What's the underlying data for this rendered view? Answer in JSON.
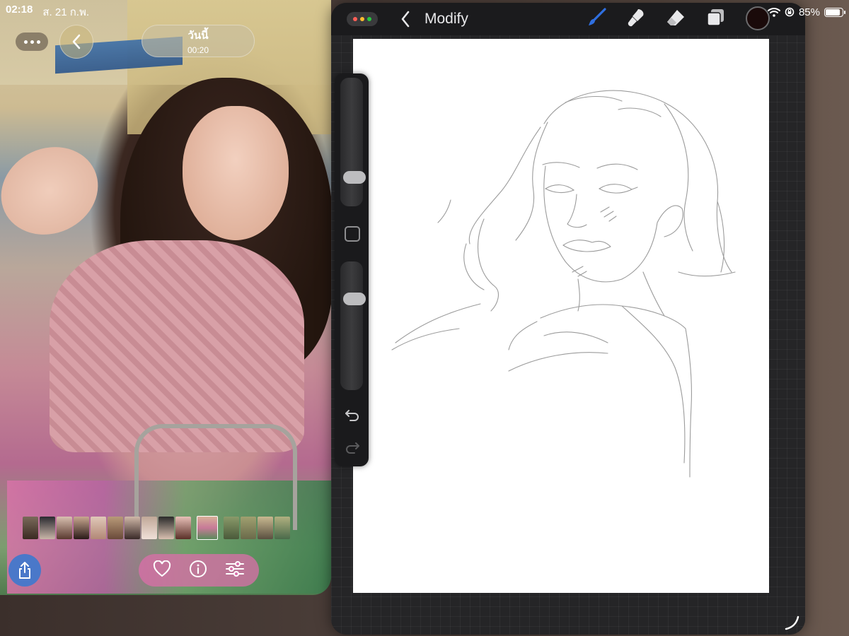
{
  "status_bar": {
    "time": "02:18",
    "date": "ส. 21 ก.พ.",
    "battery": "85%"
  },
  "photos": {
    "date_title": "วันนี้",
    "date_time": "00:20"
  },
  "procreate": {
    "title": "Modify"
  },
  "colors": {
    "accent_blue": "#2f6fe0",
    "current_color": "#1a0a0a"
  },
  "icons": {
    "more": "more-icon",
    "back": "chevron-left-icon",
    "share": "share-icon",
    "favorite": "heart-icon",
    "info": "info-icon",
    "adjust": "sliders-icon",
    "brush": "brush-icon",
    "smudge": "smudge-icon",
    "eraser": "eraser-icon",
    "layers": "layers-icon",
    "undo": "undo-icon",
    "redo": "redo-icon"
  }
}
